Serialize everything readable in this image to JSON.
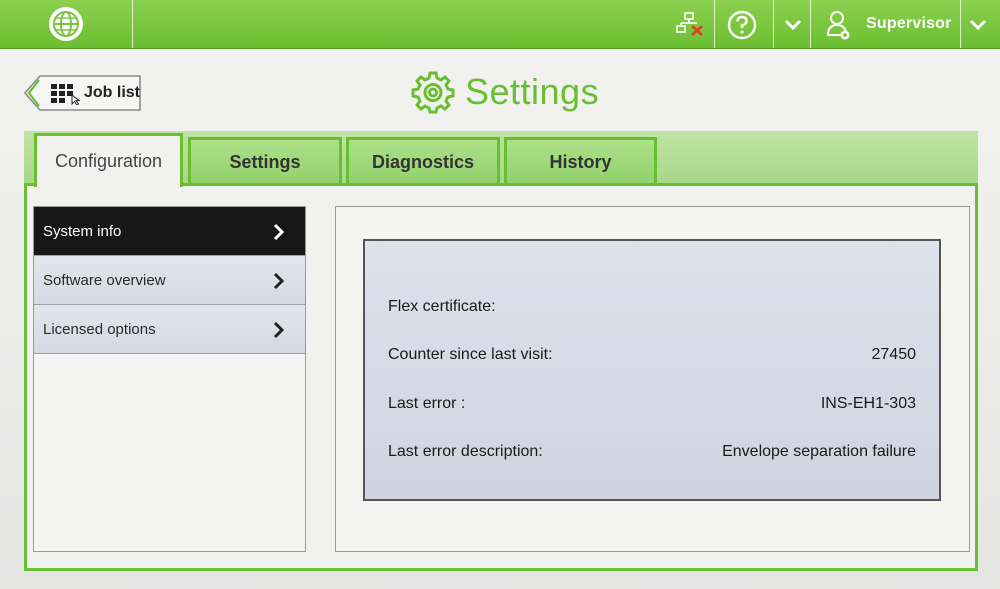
{
  "header": {
    "user_name": "Supervisor",
    "globe_icon": "globe-icon",
    "network_icon": "network-disconnected-icon",
    "help_icon": "help-icon",
    "user_icon": "user-icon"
  },
  "back": {
    "label": "Job list",
    "icon": "job-list-icon"
  },
  "page": {
    "title": "Settings",
    "icon": "gear-icon"
  },
  "tabs": [
    {
      "label": "Configuration",
      "active": true
    },
    {
      "label": "Settings",
      "active": false
    },
    {
      "label": "Diagnostics",
      "active": false
    },
    {
      "label": "History",
      "active": false
    }
  ],
  "menu": [
    {
      "label": "System info",
      "selected": true
    },
    {
      "label": "Software overview",
      "selected": false
    },
    {
      "label": "Licensed options",
      "selected": false
    }
  ],
  "info": [
    {
      "label": "Flex certificate:",
      "value": ""
    },
    {
      "label": "Counter since last visit:",
      "value": "27450"
    },
    {
      "label": "Last error :",
      "value": "INS-EH1-303"
    },
    {
      "label": "Last error description:",
      "value": "Envelope separation failure"
    }
  ],
  "colors": {
    "accent": "#6cbe31",
    "selected_menu": "#171717"
  }
}
